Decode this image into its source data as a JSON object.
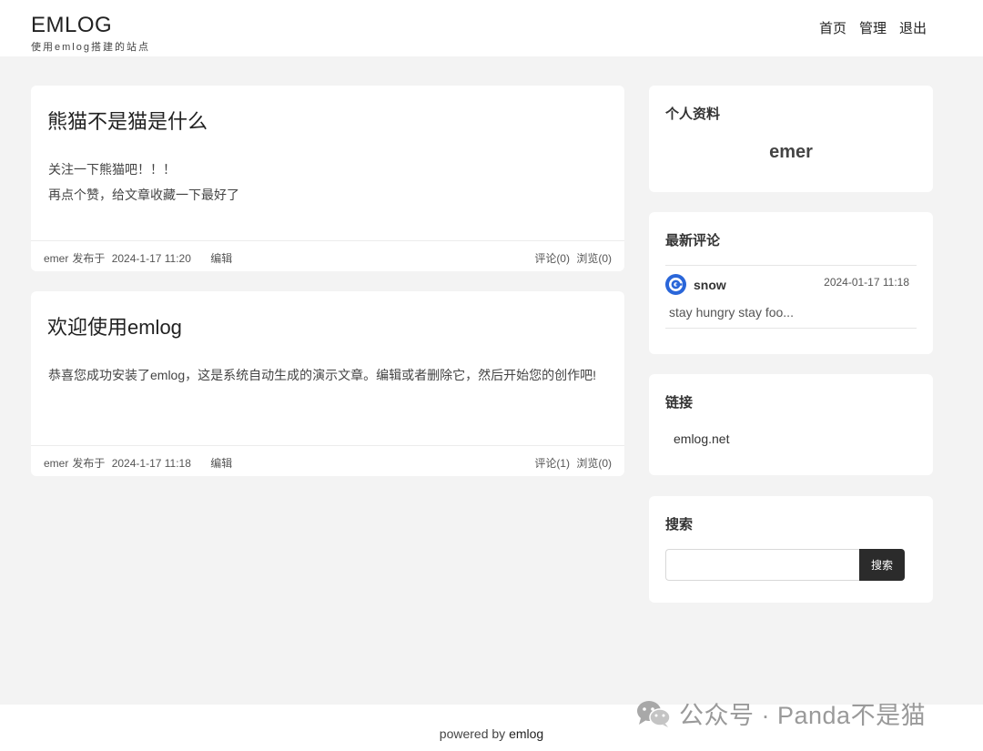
{
  "site": {
    "title": "EMLOG",
    "subtitle": "使用emlog搭建的站点"
  },
  "nav": [
    {
      "label": "首页"
    },
    {
      "label": "管理"
    },
    {
      "label": "退出"
    }
  ],
  "posts": [
    {
      "title": "熊猫不是猫是什么",
      "lines": [
        "关注一下熊猫吧！！！",
        "再点个赞，给文章收藏一下最好了"
      ],
      "author": "emer",
      "posted": "发布于",
      "date": "2024-1-17 11:20",
      "edit": "编辑",
      "comments": "评论(0)",
      "views": "浏览(0)"
    },
    {
      "title": "欢迎使用emlog",
      "lines": [
        "恭喜您成功安装了emlog，这是系统自动生成的演示文章。编辑或者删除它，然后开始您的创作吧!"
      ],
      "author": "emer",
      "posted": "发布于",
      "date": "2024-1-17 11:18",
      "edit": "编辑",
      "comments": "评论(1)",
      "views": "浏览(0)"
    }
  ],
  "sidebar": {
    "profile": {
      "title": "个人资料",
      "name": "emer"
    },
    "comments": {
      "title": "最新评论",
      "items": [
        {
          "user": "snow",
          "time": "2024-01-17 11:18",
          "text": "stay hungry stay foo...",
          "avatar_color": "#2a66d9"
        }
      ]
    },
    "links": {
      "title": "链接",
      "items": [
        {
          "label": "emlog.net"
        }
      ]
    },
    "search": {
      "title": "搜索",
      "button": "搜索",
      "value": ""
    }
  },
  "footer": {
    "prefix": "powered by",
    "brand": "emlog"
  },
  "watermark": {
    "text": "公众号 · Panda不是猫",
    "icon": "wechat-icon"
  }
}
